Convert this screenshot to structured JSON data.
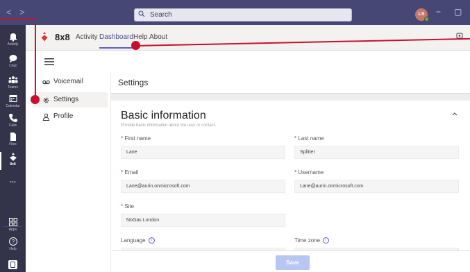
{
  "titlebar": {
    "back": "<",
    "forward": ">",
    "search_label": "Search",
    "avatar_initials": "LS",
    "minimize": "−",
    "maximize": "▢"
  },
  "rail": {
    "items": [
      {
        "label": "Activity",
        "icon": "bell-icon"
      },
      {
        "label": "Chat",
        "icon": "chat-icon"
      },
      {
        "label": "Teams",
        "icon": "teams-icon"
      },
      {
        "label": "Calendar",
        "icon": "calendar-icon"
      },
      {
        "label": "Calls",
        "icon": "phone-icon"
      },
      {
        "label": "Files",
        "icon": "file-icon"
      },
      {
        "label": "8x8",
        "icon": "8x8-logo-icon"
      },
      {
        "label": "...",
        "icon": "more-icon"
      },
      {
        "label": "Apps",
        "icon": "apps-icon"
      },
      {
        "label": "Help",
        "icon": "help-icon"
      }
    ]
  },
  "appbar": {
    "app_name": "8x8",
    "tabs": [
      "Activity",
      "Dashboard",
      "Help",
      "About"
    ],
    "active_tab": "Dashboard"
  },
  "sidenav": {
    "items": [
      {
        "label": "Voicemail",
        "icon": "voicemail-icon"
      },
      {
        "label": "Settings",
        "icon": "gear-icon"
      },
      {
        "label": "Profile",
        "icon": "person-icon"
      }
    ],
    "active": "Settings"
  },
  "main": {
    "header": "Settings",
    "card": {
      "title": "Basic information",
      "subtitle": "Provide basic information about the user or contact.",
      "fields": {
        "first_name": {
          "label": "First name",
          "value": "Lane"
        },
        "last_name": {
          "label": "Last name",
          "value": "Splitter"
        },
        "email": {
          "label": "Email",
          "value": "Lane@aurin.onmicrosoft.com"
        },
        "username": {
          "label": "Username",
          "value": "Lane@aurin.onmicrosoft.com"
        },
        "site": {
          "label": "Site",
          "value": "NoGas London"
        },
        "language": {
          "label": "Language"
        },
        "timezone": {
          "label": "Time zone"
        }
      }
    },
    "save_label": "Save"
  },
  "colors": {
    "titlebar": "#464775",
    "rail": "#33344a",
    "accent": "#5b5fc7",
    "annotation": "#c8102e",
    "brand_red": "#d93831"
  }
}
